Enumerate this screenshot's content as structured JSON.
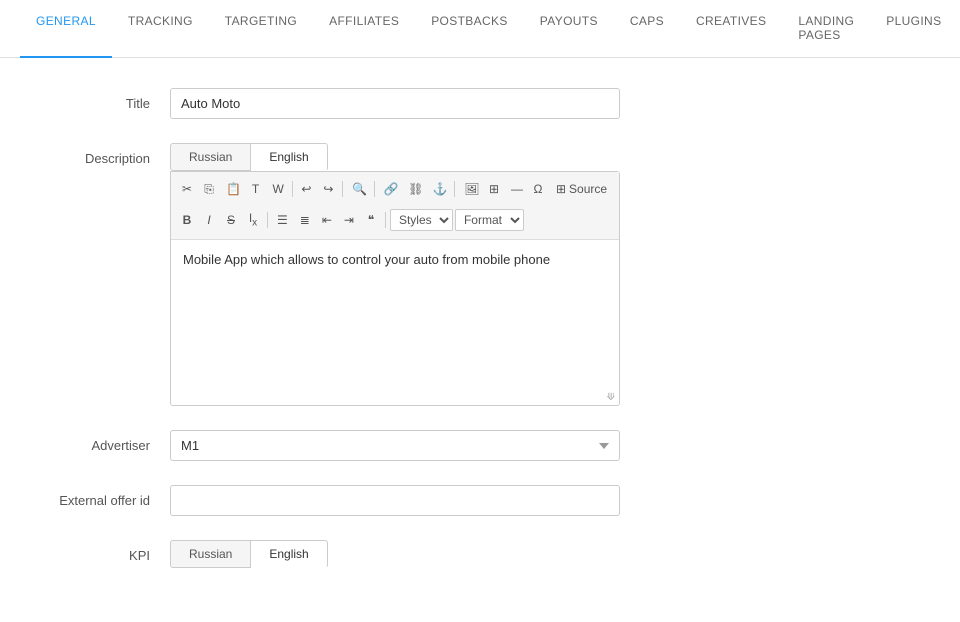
{
  "nav": {
    "items": [
      {
        "label": "GENERAL",
        "active": true
      },
      {
        "label": "TRACKING",
        "active": false
      },
      {
        "label": "TARGETING",
        "active": false
      },
      {
        "label": "AFFILIATES",
        "active": false
      },
      {
        "label": "POSTBACKS",
        "active": false
      },
      {
        "label": "PAYOUTS",
        "active": false
      },
      {
        "label": "CAPS",
        "active": false
      },
      {
        "label": "CREATIVES",
        "active": false
      },
      {
        "label": "LANDING PAGES",
        "active": false
      },
      {
        "label": "PLUGINS",
        "active": false
      }
    ]
  },
  "form": {
    "title_label": "Title",
    "title_value": "Auto Moto",
    "description_label": "Description",
    "description_tabs": [
      {
        "label": "Russian",
        "active": false
      },
      {
        "label": "English",
        "active": true
      }
    ],
    "description_text": "Mobile App which allows to control your auto from mobile phone",
    "toolbar_row1": {
      "cut": "✂",
      "copy": "⎘",
      "paste": "📋",
      "paste_text": "⬜",
      "paste_word": "W",
      "undo": "↩",
      "redo": "↪",
      "find": "🔍",
      "link": "🔗",
      "unlink": "⛓",
      "flag": "⚑",
      "image": "🖼",
      "table": "⊞",
      "hr": "—",
      "special": "Ω",
      "source_icon": "⊞",
      "source_label": "Source"
    },
    "toolbar_row2": {
      "bold": "B",
      "italic": "I",
      "strike": "S",
      "subscript": "Ix",
      "ol": "≡",
      "ul": "≡",
      "outdent": "⇤",
      "indent": "⇥",
      "quote": "❝",
      "styles_label": "Styles",
      "format_label": "Format"
    },
    "advertiser_label": "Advertiser",
    "advertiser_value": "M1",
    "external_offer_id_label": "External offer id",
    "external_offer_id_value": "",
    "kpi_label": "KPI",
    "kpi_tabs": [
      {
        "label": "Russian",
        "active": false
      },
      {
        "label": "English",
        "active": true
      }
    ]
  },
  "colors": {
    "active_tab": "#2196f3",
    "toolbar_bg": "#f5f5f5",
    "border": "#cccccc"
  }
}
